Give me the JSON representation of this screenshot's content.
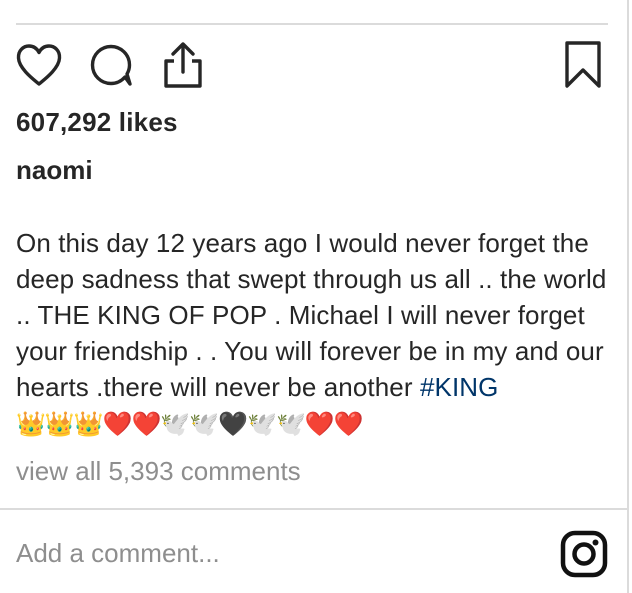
{
  "post": {
    "likes_text": "607,292 likes",
    "username": "naomi",
    "caption_text": "On this day 12 years ago I would never forget the deep sadness that swept through us all .. the world .. THE KING OF POP . Michael I will never forget your friendship . . You will forever be in my and our hearts .there will never be another",
    "hashtag": "#KING",
    "emojis": "👑👑👑❤️❤️🕊️🕊️🖤🕊️🕊️❤️❤️",
    "view_comments_text": "view all 5,393 comments",
    "comment_placeholder": "Add a comment..."
  },
  "icons": {
    "like": "heart-icon",
    "comment": "comment-bubble-icon",
    "share": "share-icon",
    "save": "bookmark-icon",
    "camera": "instagram-icon"
  },
  "colors": {
    "text": "#262626",
    "muted": "#8e8e8e",
    "hashtag": "#003569",
    "divider": "#dbdbdb"
  }
}
